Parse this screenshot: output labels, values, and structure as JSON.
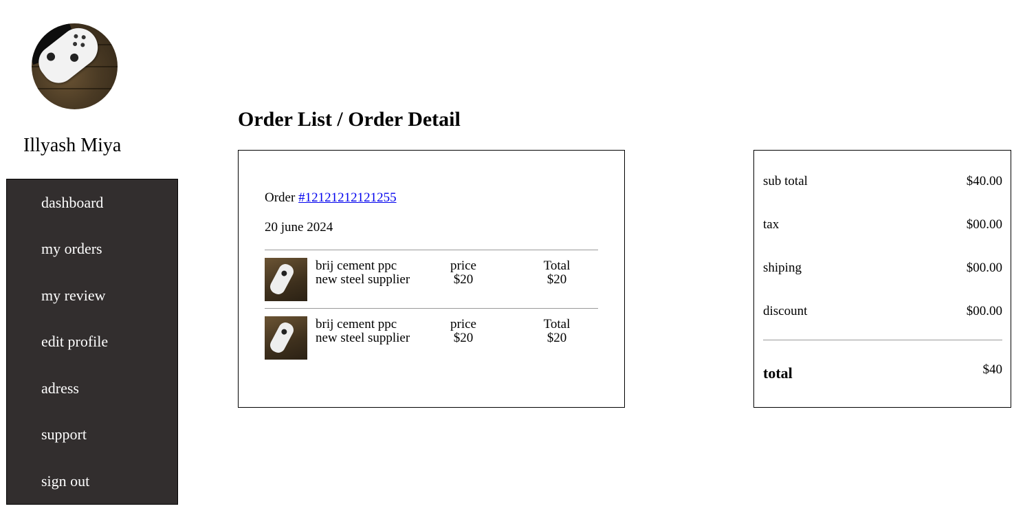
{
  "user": {
    "name": "Illyash Miya"
  },
  "sidebar": {
    "items": [
      {
        "label": "dashboard"
      },
      {
        "label": "my orders"
      },
      {
        "label": "my review"
      },
      {
        "label": "edit profile"
      },
      {
        "label": "adress"
      },
      {
        "label": "support"
      },
      {
        "label": "sign out"
      }
    ]
  },
  "page": {
    "title": "Order List / Order Detail"
  },
  "order": {
    "prefix": "Order",
    "number": "#12121212121255",
    "date": "20 june 2024",
    "items": [
      {
        "name_line1": "brij cement ppc",
        "name_line2": "new steel supplier",
        "price_label": "price",
        "price_value": "$20",
        "total_label": "Total",
        "total_value": "$20"
      },
      {
        "name_line1": "brij cement ppc",
        "name_line2": "new steel supplier",
        "price_label": "price",
        "price_value": "$20",
        "total_label": "Total",
        "total_value": "$20"
      }
    ]
  },
  "summary": {
    "rows": [
      {
        "label": "sub total",
        "value": "$40.00"
      },
      {
        "label": "tax",
        "value": "$00.00"
      },
      {
        "label": "shiping",
        "value": "$00.00"
      },
      {
        "label": "discount",
        "value": "$00.00"
      }
    ],
    "total_label": "total",
    "total_value": "$40"
  },
  "colors": {
    "sidebar_bg": "#322e2e",
    "link": "#0000ee"
  }
}
